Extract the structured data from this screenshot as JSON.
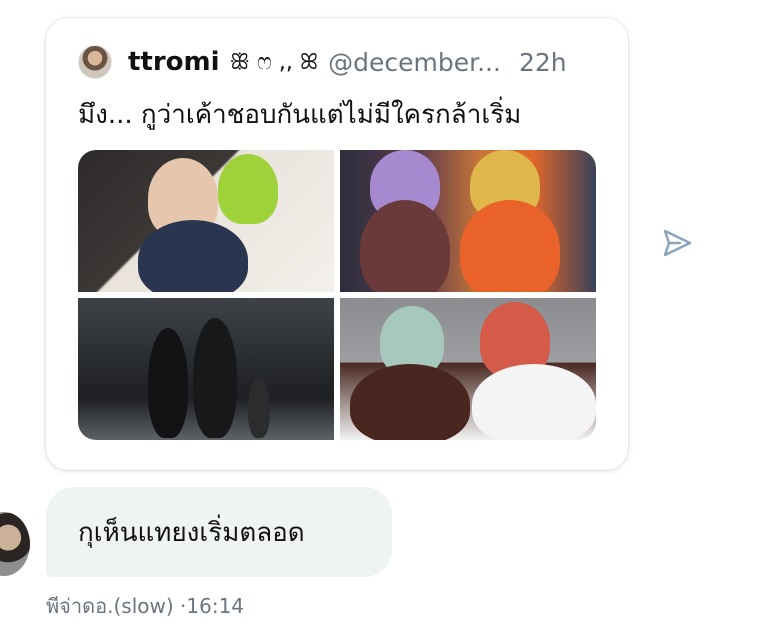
{
  "quoted_post": {
    "author_name": "ttromi",
    "author_decoration": "ꕥ ෆ ,, ꕤ",
    "author_handle": "@december...",
    "timestamp": "22h",
    "text": "มึง... กูว่าเค้าชอบกันแต่ไม่มีใครกล้าเริ่ม",
    "media_count": 4
  },
  "message": {
    "text": "กุเห็นแทยงเริ่มตลอด",
    "sender": "พีจ่าดอ.(slow)",
    "time": "16:14",
    "separator": "·"
  },
  "icons": {
    "share": "paper-plane-icon"
  },
  "colors": {
    "bubble_bg": "#eff3f4",
    "muted_text": "#6b7580",
    "icon": "#8aa3b8"
  }
}
